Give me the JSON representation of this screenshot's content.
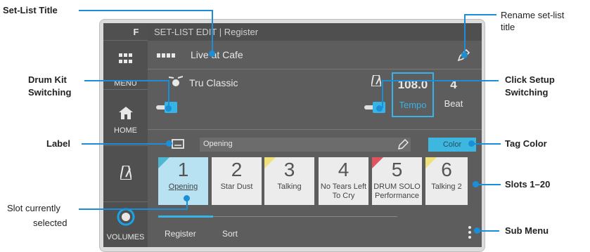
{
  "callouts": {
    "set_list_title": "Set-List Title",
    "rename": "Rename set-list title",
    "drum_kit_1": "Drum Kit",
    "drum_kit_2": "Switching",
    "click_setup_1": "Click Setup",
    "click_setup_2": "Switching",
    "label": "Label",
    "tag_color": "Tag Color",
    "slots": "Slots 1–20",
    "slot_selected_1": "Slot currently",
    "slot_selected_2": "selected",
    "sub_menu": "Sub Menu"
  },
  "sidebar": {
    "logo": "F",
    "menu": "MENU",
    "home": "HOME",
    "volumes": "VOLUMES"
  },
  "header": {
    "title": "SET-LIST EDIT | Register"
  },
  "setlist": {
    "title": "Live at Cafe"
  },
  "kit": {
    "name": "Tru Classic"
  },
  "click": {
    "tempo_value": "108.0",
    "tempo_label": "Tempo",
    "beat_value": "4",
    "beat_label": "Beat"
  },
  "label_field": {
    "value": "Opening"
  },
  "color_button": {
    "label": "Color"
  },
  "slots": [
    {
      "num": "1",
      "name": "Opening",
      "tag": "#4fb7cf"
    },
    {
      "num": "2",
      "name": "Star Dust",
      "tag": ""
    },
    {
      "num": "3",
      "name": "Talking",
      "tag": "#f0e27a"
    },
    {
      "num": "4",
      "name": "No Tears Left To Cry",
      "tag": ""
    },
    {
      "num": "5",
      "name": "DRUM SOLO Performance",
      "tag": "#e2535e"
    },
    {
      "num": "6",
      "name": "Talking 2",
      "tag": "#f0e27a"
    }
  ],
  "tabs": {
    "register": "Register",
    "sort": "Sort"
  },
  "colors": {
    "accent": "#1a8fd8",
    "selected_slot": "#b8e2f2",
    "color_button": "#3db7e0"
  }
}
